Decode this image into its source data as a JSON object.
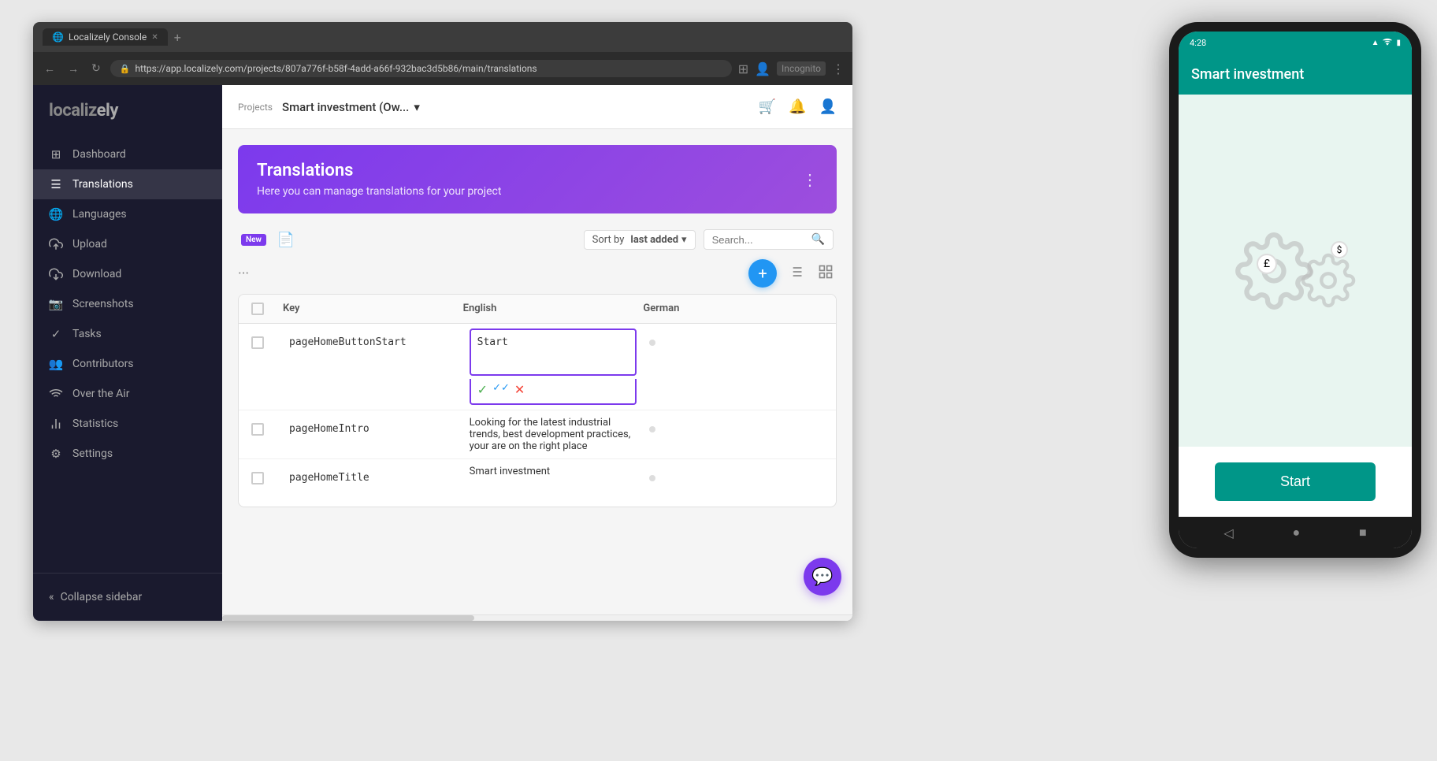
{
  "browser": {
    "tab_label": "Localizely Console",
    "tab_icon": "🌐",
    "url": "https://app.localizely.com/projects/807a776f-b58f-4add-a66f-932bac3d5b86/main/translations",
    "new_tab_icon": "+",
    "nav_back": "←",
    "nav_forward": "→",
    "nav_reload": "↻"
  },
  "topbar": {
    "breadcrumb": "Projects",
    "project_name": "Smart investment (Ow...",
    "dropdown_icon": "▾",
    "icon_cart": "🛒",
    "icon_bell": "🔔",
    "icon_user": "👤"
  },
  "sidebar": {
    "logo": "localiz",
    "logo_accent": "ely",
    "items": [
      {
        "label": "Dashboard",
        "icon": "⊞",
        "active": false
      },
      {
        "label": "Translations",
        "icon": "☰",
        "active": true
      },
      {
        "label": "Languages",
        "icon": "🌐",
        "active": false
      },
      {
        "label": "Upload",
        "icon": "☁↑",
        "active": false
      },
      {
        "label": "Download",
        "icon": "☁↓",
        "active": false
      },
      {
        "label": "Screenshots",
        "icon": "📷",
        "active": false
      },
      {
        "label": "Tasks",
        "icon": "✓",
        "active": false
      },
      {
        "label": "Contributors",
        "icon": "👥",
        "active": false
      },
      {
        "label": "Over the Air",
        "icon": "📶",
        "active": false
      },
      {
        "label": "Statistics",
        "icon": "📊",
        "active": false
      },
      {
        "label": "Settings",
        "icon": "⚙",
        "active": false
      }
    ],
    "collapse_label": "Collapse sidebar",
    "collapse_icon": "«"
  },
  "page": {
    "banner_title": "Translations",
    "banner_subtitle": "Here you can manage translations for your project",
    "banner_menu_icon": "⋮",
    "new_badge": "New",
    "sort_label": "Sort by",
    "sort_value": "last added",
    "sort_arrow": "▾",
    "search_placeholder": "Search...",
    "more_dots": "···",
    "add_icon": "+",
    "filter_icon": "≡",
    "grid_icon": "⊞"
  },
  "table": {
    "headers": [
      "",
      "Key",
      "English",
      "German"
    ],
    "rows": [
      {
        "key": "pageHomeButtonStart",
        "english": "Start",
        "german": "",
        "editing": true
      },
      {
        "key": "pageHomeIntro",
        "english": "Looking for the latest industrial trends, best development practices, your are on the right place",
        "german": "",
        "editing": false
      },
      {
        "key": "pageHomeTitle",
        "english": "Smart investment",
        "german": "",
        "editing": false
      }
    ],
    "edit_actions": {
      "confirm": "✓",
      "auto": "✓✓",
      "discard": "✕"
    }
  },
  "chat_btn": "💬",
  "phone": {
    "status_time": "4:28",
    "status_dot": "●",
    "signal_icon": "▲▲▲",
    "wifi_icon": "wifi",
    "battery_icon": "▮",
    "app_title": "Smart investment",
    "start_button": "Start",
    "nav_back": "◁",
    "nav_home": "●",
    "nav_recent": "■"
  }
}
